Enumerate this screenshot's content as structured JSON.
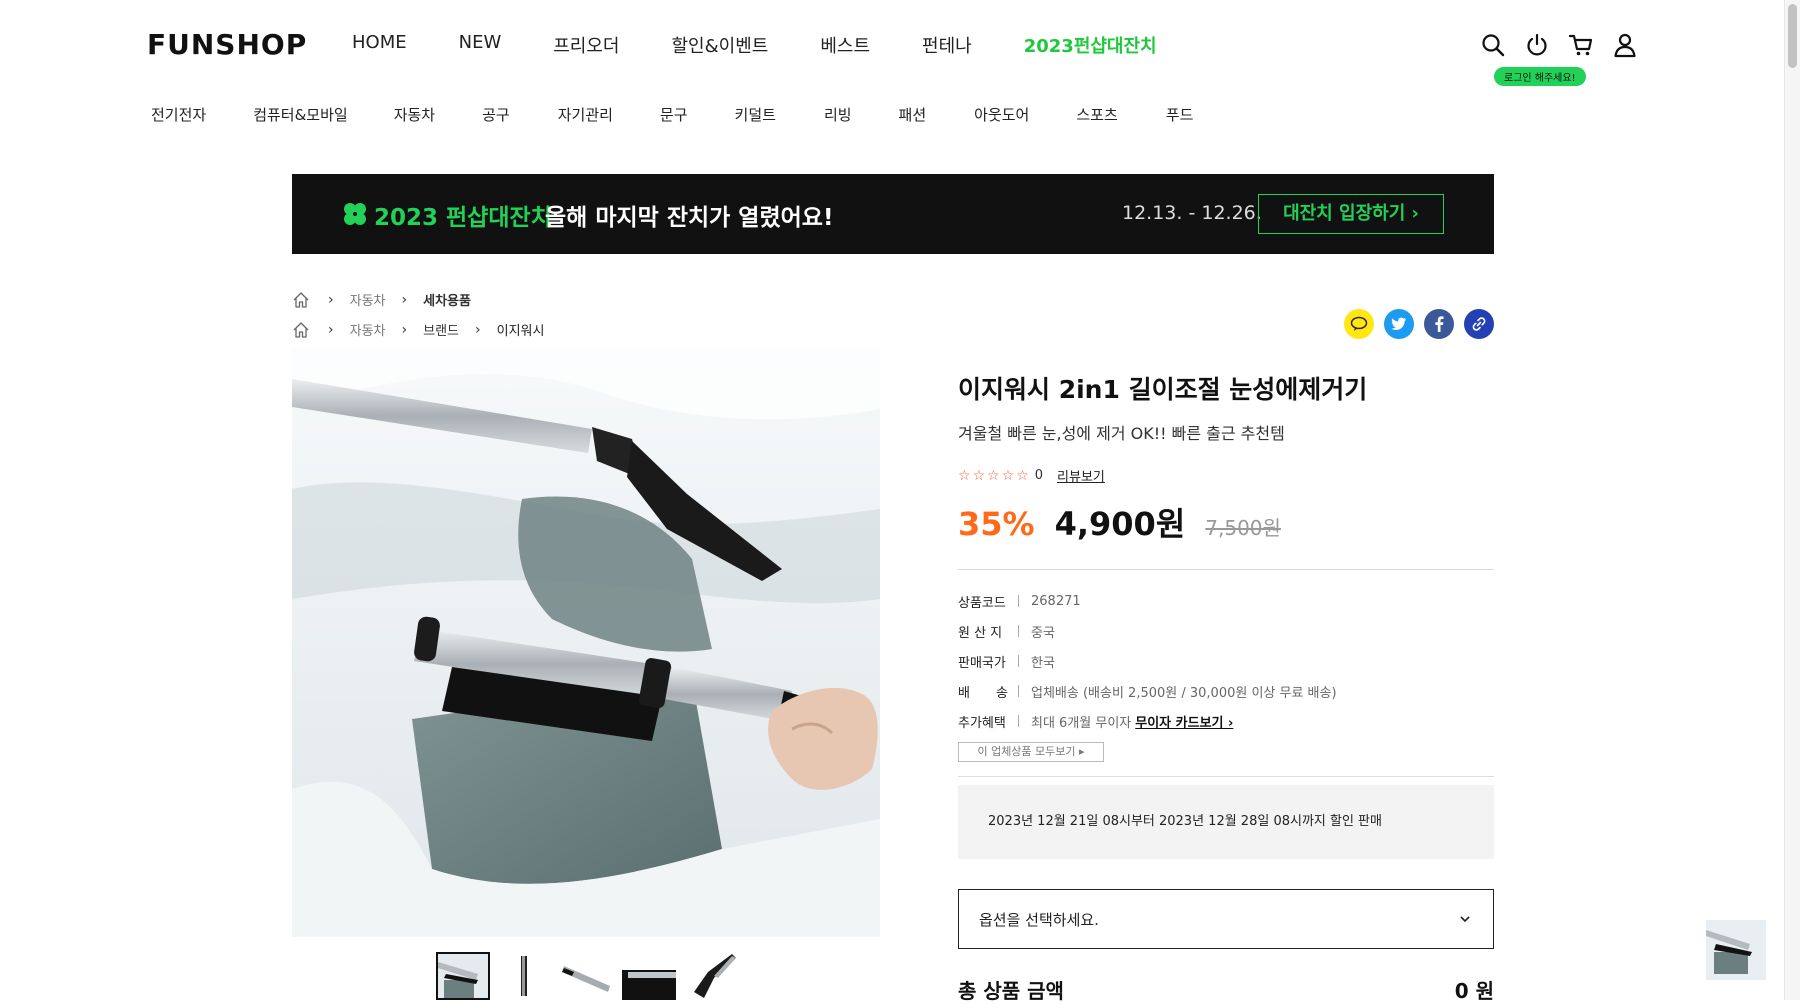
{
  "header": {
    "logo": "FUNSHOP",
    "nav": [
      "HOME",
      "NEW",
      "프리오더",
      "할인&이벤트",
      "베스트",
      "펀테나",
      "2023펀샵대잔치"
    ],
    "login_tooltip": "로그인 해주세요!"
  },
  "categories": [
    "전기전자",
    "컴퓨터&모바일",
    "자동차",
    "공구",
    "자기관리",
    "문구",
    "키덜트",
    "리빙",
    "패션",
    "아웃도어",
    "스포츠",
    "푸드"
  ],
  "banner": {
    "title": "2023 펀샵대잔치",
    "subtitle": "올해 마지막 잔치가 열렸어요!",
    "date": "12.13. - 12.26.",
    "button": "대잔치 입장하기 ›"
  },
  "breadcrumbs": [
    [
      "자동차",
      "세차용품"
    ],
    [
      "자동차",
      "브랜드",
      "이지워시"
    ]
  ],
  "product": {
    "name": "이지워시 2in1 길이조절 눈성에제거기",
    "desc": "겨울철 빠른 눈,성에 제거 OK!! 빠른 출근 추천템",
    "stars": "☆☆☆☆☆",
    "review_count": "0",
    "review_link": "리뷰보기",
    "discount_rate": "35%",
    "sale_price": "4,900원",
    "original_price": "7,500원"
  },
  "spec": {
    "code_label": "상품코드",
    "code": "268271",
    "origin_label": "원 산 지",
    "origin": "중국",
    "country_label": "판매국가",
    "country": "한국",
    "ship_label": "배　　송",
    "ship": "업체배송 (배송비 2,500원 / 30,000원 이상 무료 배송)",
    "benefit_label": "추가혜택",
    "benefit": "최대 6개월 무이자",
    "benefit_link": "무이자 카드보기 ›",
    "all_button": "이 업체상품 모두보기 ▸"
  },
  "notice": "2023년 12월 21일 08시부터 2023년 12월 28일 08시까지 할인 판매",
  "option_placeholder": "옵션을 선택하세요.",
  "total": {
    "label": "총 상품 금액",
    "value": "0 원"
  }
}
